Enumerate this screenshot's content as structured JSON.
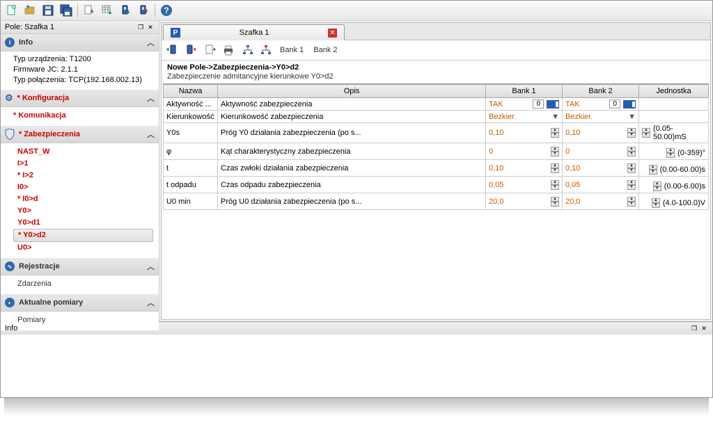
{
  "toolbar": {
    "help": "?"
  },
  "sidebar": {
    "title": "Pole: Szafka 1",
    "info": {
      "label": "Info",
      "device_type": "Typ urządzenia: T1200",
      "firmware": "Firmware JC: 2.1.1",
      "connection": "Typ połączenia: TCP(192.168.002.13)"
    },
    "config": {
      "label": "* Konfiguracja"
    },
    "comm": {
      "label": "* Komunikacja"
    },
    "prot": {
      "label": "* Zabezpieczenia",
      "items": [
        {
          "label": "NAST_W"
        },
        {
          "label": "I>1"
        },
        {
          "label": "* I>2"
        },
        {
          "label": "I0>"
        },
        {
          "label": "* I0>d"
        },
        {
          "label": "Y0>"
        },
        {
          "label": "Y0>d1"
        },
        {
          "label": "* Y0>d2"
        },
        {
          "label": "U0>"
        }
      ]
    },
    "rec": {
      "label": "Rejestracje",
      "sub": "Zdarzenia"
    },
    "meas": {
      "label": "Aktualne pomiary",
      "sub": "Pomiary"
    }
  },
  "tab": {
    "title": "Szafka 1"
  },
  "subtool": {
    "bank1": "Bank 1",
    "bank2": "Bank 2"
  },
  "breadcrumb": "Nowe Pole->Zabezpieczenia->Y0>d2",
  "breadcrumb_sub": "Zabezpieczenie admitancyjne kierunkowe Y0>d2",
  "grid": {
    "headers": {
      "name": "Nazwa",
      "desc": "Opis",
      "b1": "Bank 1",
      "b2": "Bank 2",
      "unit": "Jednostka"
    },
    "rows": [
      {
        "name": "Aktywność ...",
        "desc": "Aktywność zabezpieczenia",
        "b1": "TAK",
        "b1n": "0",
        "b2": "TAK",
        "b2n": "0",
        "unit": "",
        "type": "toggle"
      },
      {
        "name": "Kierunkowość",
        "desc": "Kierunkowość zabezpieczenia",
        "b1": "Bezkier.",
        "b2": "Bezkier.",
        "unit": "",
        "type": "combo"
      },
      {
        "name": "Y0s",
        "desc": "Próg Y0 działania zabezpieczenia (po s...",
        "b1": "0,10",
        "b2": "0,10",
        "unit": "(0.05-50.00)mS",
        "type": "spin"
      },
      {
        "name": "φ",
        "desc": "Kąt charakterystyczny zabezpieczenia",
        "b1": "0",
        "b2": "0",
        "unit": "(0-359)°",
        "type": "spin"
      },
      {
        "name": "t",
        "desc": "Czas zwłoki działania zabezpieczenia",
        "b1": "0,10",
        "b2": "0,10",
        "unit": "(0.00-60.00)s",
        "type": "spin"
      },
      {
        "name": "t odpadu",
        "desc": "Czas odpadu zabezpieczenia",
        "b1": "0,05",
        "b2": "0,05",
        "unit": "(0.00-6.00)s",
        "type": "spin"
      },
      {
        "name": "U0 min",
        "desc": "Próg U0 działania zabezpieczenia (po s...",
        "b1": "20,0",
        "b2": "20,0",
        "unit": "(4.0-100.0)V",
        "type": "spin"
      }
    ]
  },
  "info_panel": {
    "title": "Info"
  }
}
